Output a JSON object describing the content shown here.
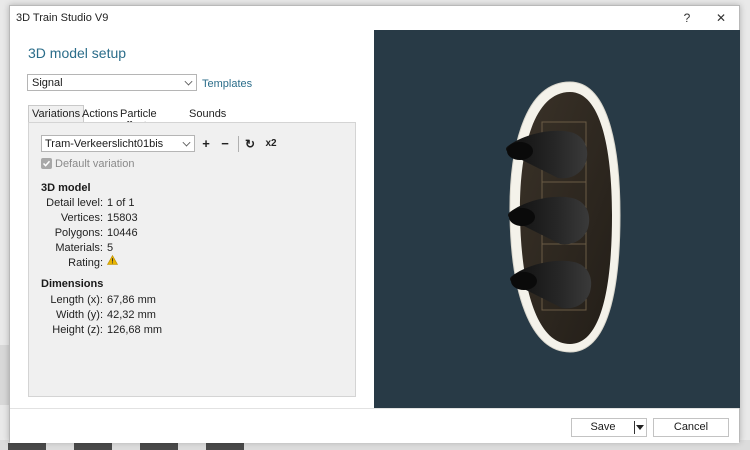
{
  "window": {
    "title": "3D Train Studio V9",
    "help_label": "?",
    "close_label": "✕"
  },
  "setup": {
    "heading": "3D model setup",
    "category_value": "Signal",
    "templates_link": "Templates"
  },
  "tabs": [
    {
      "label": "Variations",
      "active": true
    },
    {
      "label": "Actions",
      "active": false
    },
    {
      "label": "Particle effects",
      "active": false
    },
    {
      "label": "Sounds",
      "active": false
    }
  ],
  "variation": {
    "selected": "Tram-Verkeerslicht01bis",
    "toolbar": {
      "add": "+",
      "remove": "−",
      "refresh": "↻",
      "duplicate": "x2"
    },
    "default_checked": true,
    "default_label": "Default variation"
  },
  "model": {
    "title": "3D model",
    "rows": [
      {
        "label": "Detail level:",
        "value": "1 of 1"
      },
      {
        "label": "Vertices:",
        "value": "15803"
      },
      {
        "label": "Polygons:",
        "value": "10446"
      },
      {
        "label": "Materials:",
        "value": "5"
      },
      {
        "label": "Rating:",
        "value": ""
      }
    ],
    "rating_icon": "warning-icon"
  },
  "dimensions": {
    "title": "Dimensions",
    "rows": [
      {
        "label": "Length (x):",
        "value": "67,86 mm"
      },
      {
        "label": "Width (y):",
        "value": "42,32 mm"
      },
      {
        "label": "Height (z):",
        "value": "126,68 mm"
      }
    ]
  },
  "footer": {
    "save_label": "Save",
    "cancel_label": "Cancel"
  },
  "colors": {
    "accent": "#2b6d8a",
    "viewport_bg": "#283a46",
    "warning": "#e8b400"
  }
}
